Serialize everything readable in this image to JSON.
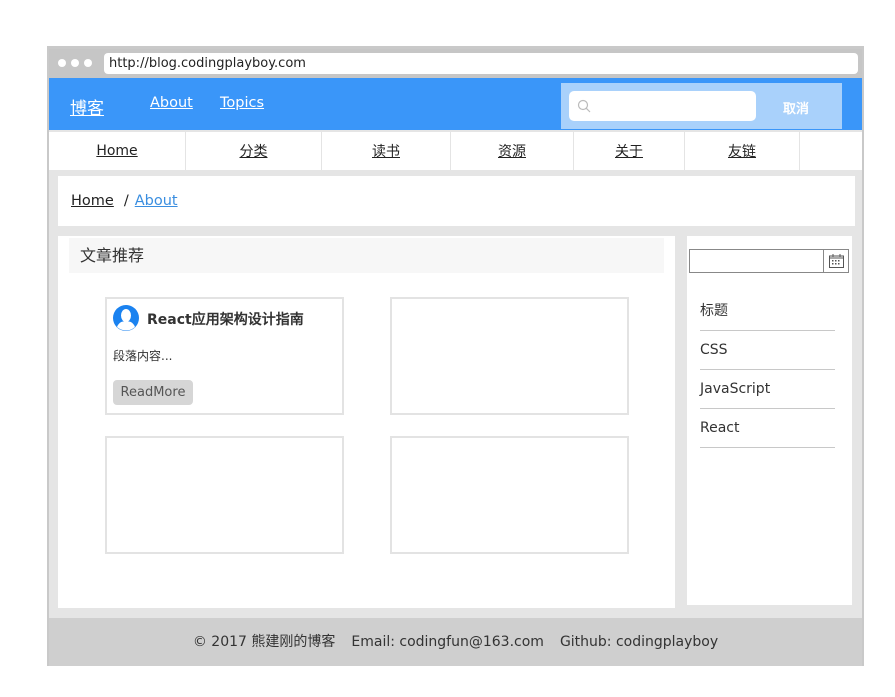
{
  "browser": {
    "url": "http://blog.codingplayboy.com"
  },
  "header": {
    "brand": "博客",
    "links": [
      "About",
      "Topics"
    ],
    "search_placeholder": "",
    "cancel_label": "取消",
    "accent_color": "#3a96f9"
  },
  "nav": {
    "items": [
      "Home",
      "分类",
      "读书",
      "资源",
      "关于",
      "友链",
      ""
    ]
  },
  "breadcrumb": {
    "home": "Home",
    "separator": "/",
    "current": "About"
  },
  "main": {
    "section_title": "文章推荐",
    "cards": [
      {
        "title": "React应用架构设计指南",
        "text": "段落内容...",
        "button": "ReadMore"
      },
      {
        "title": "",
        "text": "",
        "button": ""
      },
      {
        "title": "",
        "text": "",
        "button": ""
      },
      {
        "title": "",
        "text": "",
        "button": ""
      }
    ]
  },
  "sidebar": {
    "date_value": "",
    "items": [
      "标题",
      "CSS",
      "JavaScript",
      "React"
    ]
  },
  "footer": {
    "copyright": "© 2017 熊建刚的博客",
    "email": "Email: codingfun@163.com",
    "github": "Github: codingplayboy"
  }
}
